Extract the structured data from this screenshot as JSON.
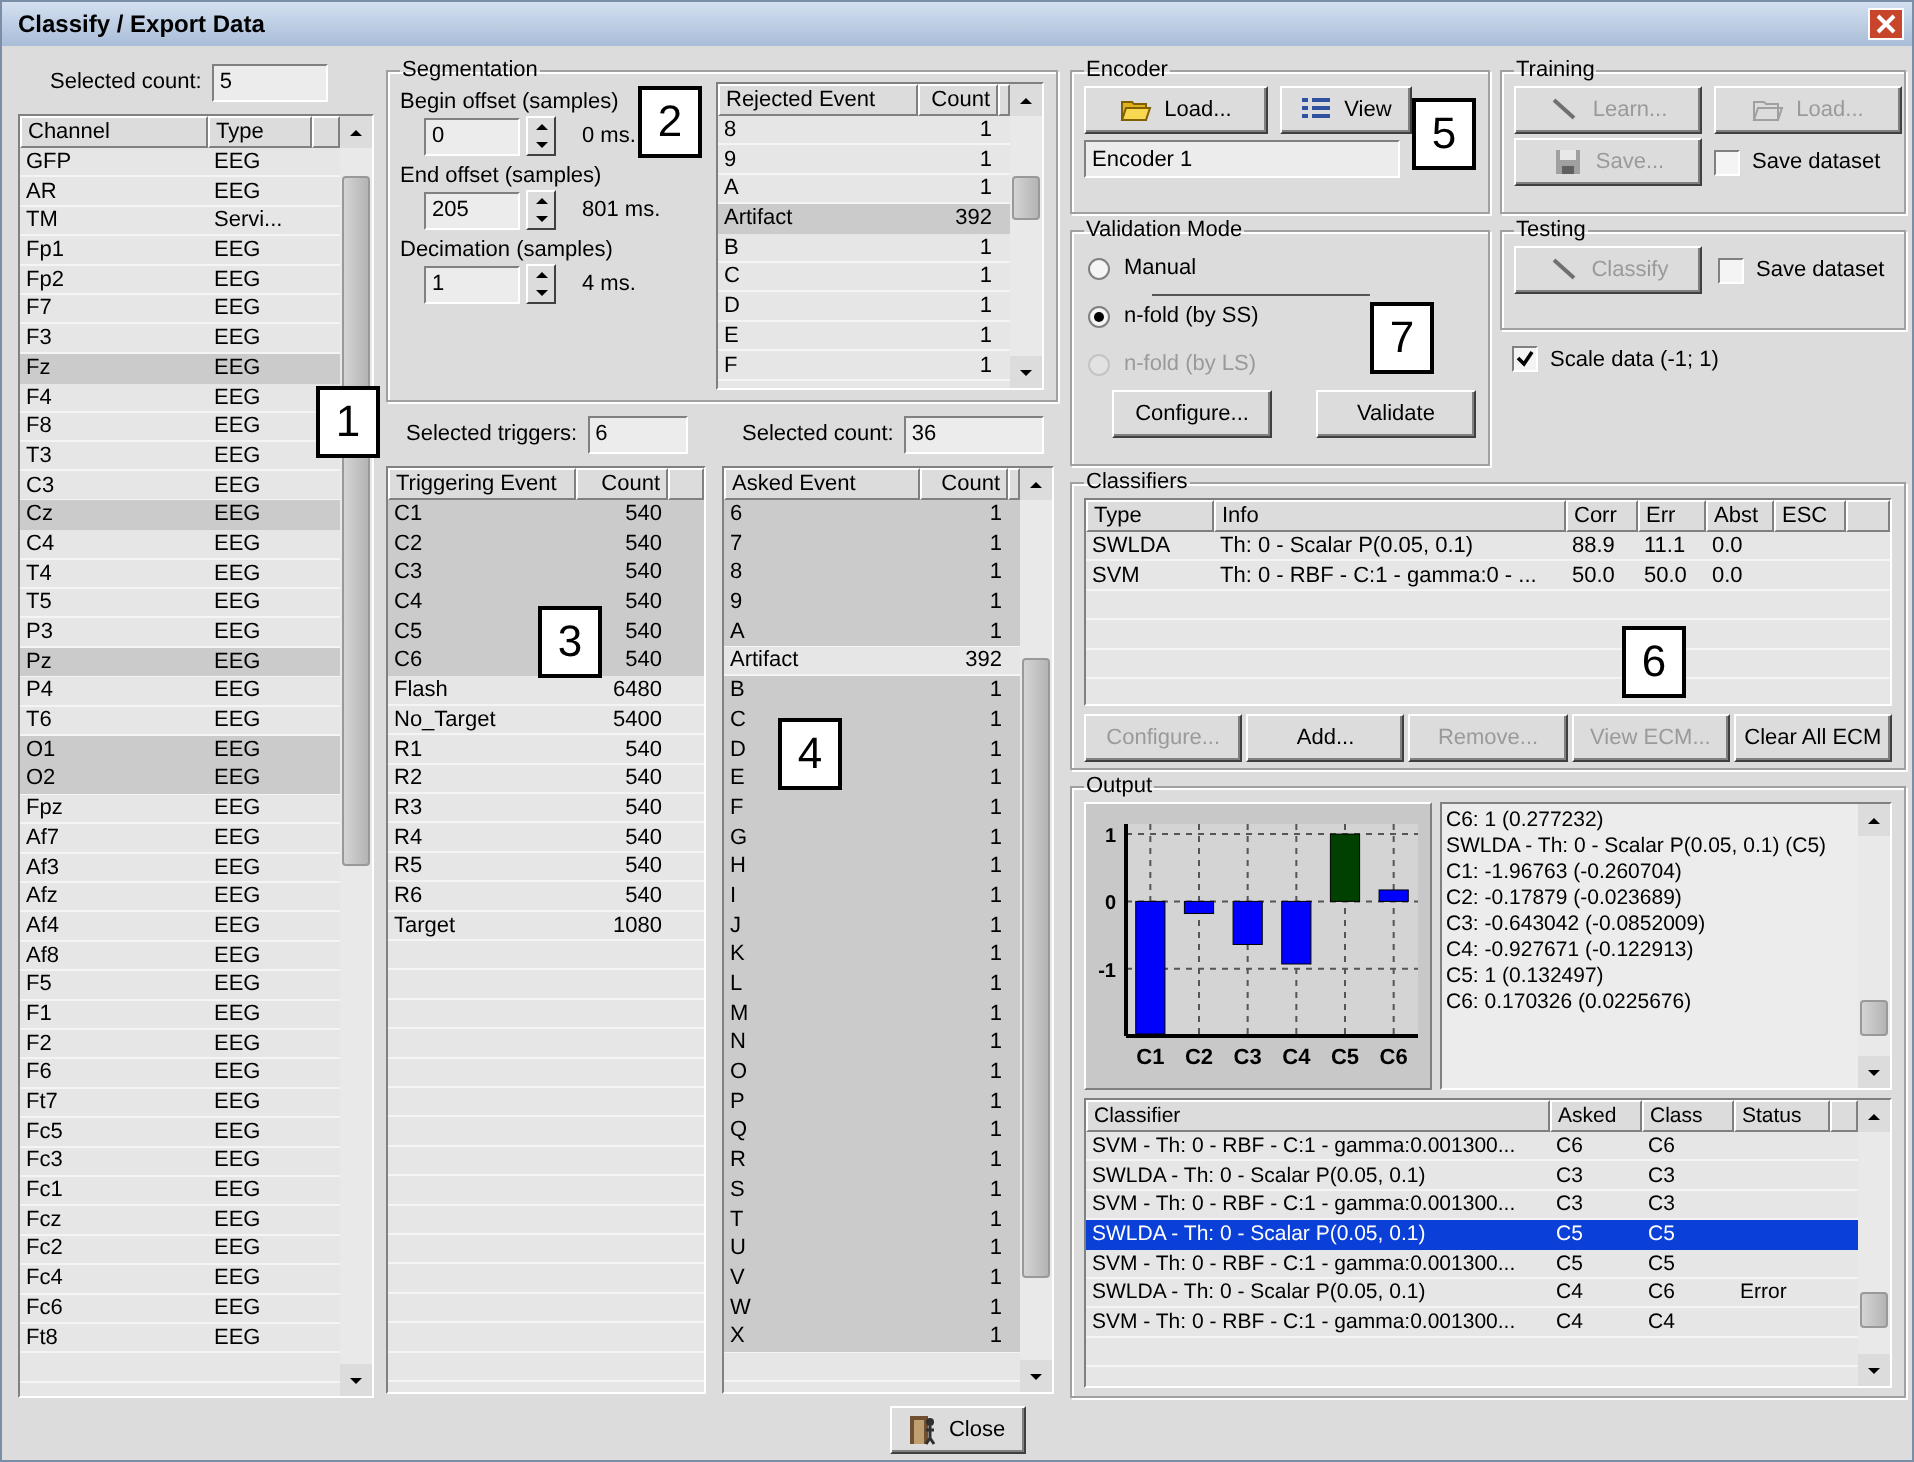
{
  "window": {
    "title": "Classify / Export Data"
  },
  "channels": {
    "count_label": "Selected count:",
    "count": "5",
    "columns": [
      "Channel",
      "Type"
    ],
    "rows": [
      {
        "channel": "GFP",
        "type": "EEG",
        "selected": false
      },
      {
        "channel": "AR",
        "type": "EEG",
        "selected": false
      },
      {
        "channel": "TM",
        "type": "Servi...",
        "selected": false
      },
      {
        "channel": "Fp1",
        "type": "EEG",
        "selected": false
      },
      {
        "channel": "Fp2",
        "type": "EEG",
        "selected": false
      },
      {
        "channel": "F7",
        "type": "EEG",
        "selected": false
      },
      {
        "channel": "F3",
        "type": "EEG",
        "selected": false
      },
      {
        "channel": "Fz",
        "type": "EEG",
        "selected": true
      },
      {
        "channel": "F4",
        "type": "EEG",
        "selected": false
      },
      {
        "channel": "F8",
        "type": "EEG",
        "selected": false
      },
      {
        "channel": "T3",
        "type": "EEG",
        "selected": false
      },
      {
        "channel": "C3",
        "type": "EEG",
        "selected": false
      },
      {
        "channel": "Cz",
        "type": "EEG",
        "selected": true
      },
      {
        "channel": "C4",
        "type": "EEG",
        "selected": false
      },
      {
        "channel": "T4",
        "type": "EEG",
        "selected": false
      },
      {
        "channel": "T5",
        "type": "EEG",
        "selected": false
      },
      {
        "channel": "P3",
        "type": "EEG",
        "selected": false
      },
      {
        "channel": "Pz",
        "type": "EEG",
        "selected": true
      },
      {
        "channel": "P4",
        "type": "EEG",
        "selected": false
      },
      {
        "channel": "T6",
        "type": "EEG",
        "selected": false
      },
      {
        "channel": "O1",
        "type": "EEG",
        "selected": true
      },
      {
        "channel": "O2",
        "type": "EEG",
        "selected": true
      },
      {
        "channel": "Fpz",
        "type": "EEG",
        "selected": false
      },
      {
        "channel": "Af7",
        "type": "EEG",
        "selected": false
      },
      {
        "channel": "Af3",
        "type": "EEG",
        "selected": false
      },
      {
        "channel": "Afz",
        "type": "EEG",
        "selected": false
      },
      {
        "channel": "Af4",
        "type": "EEG",
        "selected": false
      },
      {
        "channel": "Af8",
        "type": "EEG",
        "selected": false
      },
      {
        "channel": "F5",
        "type": "EEG",
        "selected": false
      },
      {
        "channel": "F1",
        "type": "EEG",
        "selected": false
      },
      {
        "channel": "F2",
        "type": "EEG",
        "selected": false
      },
      {
        "channel": "F6",
        "type": "EEG",
        "selected": false
      },
      {
        "channel": "Ft7",
        "type": "EEG",
        "selected": false
      },
      {
        "channel": "Fc5",
        "type": "EEG",
        "selected": false
      },
      {
        "channel": "Fc3",
        "type": "EEG",
        "selected": false
      },
      {
        "channel": "Fc1",
        "type": "EEG",
        "selected": false
      },
      {
        "channel": "Fcz",
        "type": "EEG",
        "selected": false
      },
      {
        "channel": "Fc2",
        "type": "EEG",
        "selected": false
      },
      {
        "channel": "Fc4",
        "type": "EEG",
        "selected": false
      },
      {
        "channel": "Fc6",
        "type": "EEG",
        "selected": false
      },
      {
        "channel": "Ft8",
        "type": "EEG",
        "selected": false
      }
    ]
  },
  "segmentation": {
    "title": "Segmentation",
    "fields": [
      {
        "label": "Begin offset (samples)",
        "value": "0",
        "reading": "0 ms."
      },
      {
        "label": "End offset (samples)",
        "value": "205",
        "reading": "801 ms."
      },
      {
        "label": "Decimation (samples)",
        "value": "1",
        "reading": "4 ms."
      }
    ],
    "rejected": {
      "columns": [
        "Rejected Event",
        "Count"
      ],
      "rows": [
        {
          "event": "8",
          "count": "1",
          "selected": false
        },
        {
          "event": "9",
          "count": "1",
          "selected": false
        },
        {
          "event": "A",
          "count": "1",
          "selected": false
        },
        {
          "event": "Artifact",
          "count": "392",
          "selected": true
        },
        {
          "event": "B",
          "count": "1",
          "selected": false
        },
        {
          "event": "C",
          "count": "1",
          "selected": false
        },
        {
          "event": "D",
          "count": "1",
          "selected": false
        },
        {
          "event": "E",
          "count": "1",
          "selected": false
        },
        {
          "event": "F",
          "count": "1",
          "selected": false
        }
      ]
    }
  },
  "triggers": {
    "count_label": "Selected triggers:",
    "count": "6",
    "columns": [
      "Triggering Event",
      "Count"
    ],
    "rows": [
      {
        "event": "C1",
        "count": "540",
        "selected": true
      },
      {
        "event": "C2",
        "count": "540",
        "selected": true
      },
      {
        "event": "C3",
        "count": "540",
        "selected": true
      },
      {
        "event": "C4",
        "count": "540",
        "selected": true
      },
      {
        "event": "C5",
        "count": "540",
        "selected": true
      },
      {
        "event": "C6",
        "count": "540",
        "selected": true
      },
      {
        "event": "Flash",
        "count": "6480",
        "selected": false
      },
      {
        "event": "No_Target",
        "count": "5400",
        "selected": false
      },
      {
        "event": "R1",
        "count": "540",
        "selected": false
      },
      {
        "event": "R2",
        "count": "540",
        "selected": false
      },
      {
        "event": "R3",
        "count": "540",
        "selected": false
      },
      {
        "event": "R4",
        "count": "540",
        "selected": false
      },
      {
        "event": "R5",
        "count": "540",
        "selected": false
      },
      {
        "event": "R6",
        "count": "540",
        "selected": false
      },
      {
        "event": "Target",
        "count": "1080",
        "selected": false
      }
    ]
  },
  "asked": {
    "count_label": "Selected count:",
    "count": "36",
    "columns": [
      "Asked Event",
      "Count"
    ],
    "rows": [
      {
        "event": "6",
        "count": "1",
        "selected": true
      },
      {
        "event": "7",
        "count": "1",
        "selected": true
      },
      {
        "event": "8",
        "count": "1",
        "selected": true
      },
      {
        "event": "9",
        "count": "1",
        "selected": true
      },
      {
        "event": "A",
        "count": "1",
        "selected": true
      },
      {
        "event": "Artifact",
        "count": "392",
        "selected": false
      },
      {
        "event": "B",
        "count": "1",
        "selected": true
      },
      {
        "event": "C",
        "count": "1",
        "selected": true
      },
      {
        "event": "D",
        "count": "1",
        "selected": true
      },
      {
        "event": "E",
        "count": "1",
        "selected": true
      },
      {
        "event": "F",
        "count": "1",
        "selected": true
      },
      {
        "event": "G",
        "count": "1",
        "selected": true
      },
      {
        "event": "H",
        "count": "1",
        "selected": true
      },
      {
        "event": "I",
        "count": "1",
        "selected": true
      },
      {
        "event": "J",
        "count": "1",
        "selected": true
      },
      {
        "event": "K",
        "count": "1",
        "selected": true
      },
      {
        "event": "L",
        "count": "1",
        "selected": true
      },
      {
        "event": "M",
        "count": "1",
        "selected": true
      },
      {
        "event": "N",
        "count": "1",
        "selected": true
      },
      {
        "event": "O",
        "count": "1",
        "selected": true
      },
      {
        "event": "P",
        "count": "1",
        "selected": true
      },
      {
        "event": "Q",
        "count": "1",
        "selected": true
      },
      {
        "event": "R",
        "count": "1",
        "selected": true
      },
      {
        "event": "S",
        "count": "1",
        "selected": true
      },
      {
        "event": "T",
        "count": "1",
        "selected": true
      },
      {
        "event": "U",
        "count": "1",
        "selected": true
      },
      {
        "event": "V",
        "count": "1",
        "selected": true
      },
      {
        "event": "W",
        "count": "1",
        "selected": true
      },
      {
        "event": "X",
        "count": "1",
        "selected": true
      }
    ]
  },
  "encoder": {
    "title": "Encoder",
    "buttons": [
      {
        "label": "Load...",
        "disabled": false
      },
      {
        "label": "View",
        "disabled": false
      }
    ],
    "value": "Encoder 1"
  },
  "training": {
    "title": "Training",
    "buttons": [
      {
        "label": "Learn...",
        "disabled": true
      },
      {
        "label": "Load...",
        "disabled": true
      },
      {
        "label": "Save...",
        "disabled": true
      }
    ],
    "checkbox": {
      "label": "Save dataset",
      "checked": false
    }
  },
  "validation": {
    "title": "Validation Mode",
    "options": [
      {
        "label": "Manual",
        "selected": false,
        "disabled": false
      },
      {
        "label": "n-fold (by SS)",
        "selected": true,
        "disabled": false
      },
      {
        "label": "n-fold (by LS)",
        "selected": false,
        "disabled": true
      }
    ],
    "buttons": [
      {
        "label": "Configure...",
        "disabled": false
      },
      {
        "label": "Validate",
        "disabled": false
      }
    ]
  },
  "testing": {
    "title": "Testing",
    "buttons": [
      {
        "label": "Classify",
        "disabled": true
      }
    ],
    "checkbox": {
      "label": "Save dataset",
      "checked": false
    }
  },
  "scale_data": {
    "label": "Scale data (-1; 1)",
    "checked": true
  },
  "classifiers": {
    "title": "Classifiers",
    "columns": [
      "Type",
      "Info",
      "Corr",
      "Err",
      "Abst",
      "ESC"
    ],
    "rows": [
      {
        "type": "SWLDA",
        "info": "Th: 0 - Scalar P(0.05, 0.1)",
        "corr": "88.9",
        "err": "11.1",
        "abst": "0.0"
      },
      {
        "type": "SVM",
        "info": "Th: 0 - RBF - C:1 - gamma:0 - ...",
        "corr": "50.0",
        "err": "50.0",
        "abst": "0.0"
      }
    ],
    "buttons": [
      {
        "label": "Configure...",
        "disabled": true
      },
      {
        "label": "Add...",
        "disabled": false
      },
      {
        "label": "Remove...",
        "disabled": true
      },
      {
        "label": "View ECM...",
        "disabled": true
      },
      {
        "label": "Clear All ECM",
        "disabled": false
      }
    ]
  },
  "output": {
    "title": "Output",
    "chart_data": {
      "type": "bar",
      "categories": [
        "C1",
        "C2",
        "C3",
        "C4",
        "C5",
        "C6"
      ],
      "series": [
        {
          "color": "#0000ff",
          "values": [
            -1.97,
            -0.18,
            -0.64,
            -0.93,
            null,
            0.17
          ]
        },
        {
          "color": "#004000",
          "values": [
            null,
            null,
            null,
            null,
            1,
            null
          ]
        }
      ],
      "ylim": [
        -2,
        1.15
      ],
      "yticks": [
        -1,
        0,
        1
      ],
      "stacked": true,
      "grid": true
    },
    "log": [
      "C6: 1 (0.277232)",
      "SWLDA - Th: 0 - Scalar P(0.05, 0.1) (C5)",
      "C1: -1.96763 (-0.260704)",
      "C2: -0.17879 (-0.023689)",
      "C3: -0.643042 (-0.0852009)",
      "C4: -0.927671 (-0.122913)",
      "C5: 1 (0.132497)",
      "C6: 0.170326 (0.0225676)"
    ],
    "results": {
      "columns": [
        "Classifier",
        "Asked",
        "Class",
        "Status"
      ],
      "rows": [
        {
          "classifier": "SVM - Th: 0 - RBF - C:1 - gamma:0.001300...",
          "asked": "C6",
          "class": "C6",
          "selected": false
        },
        {
          "classifier": "SWLDA - Th: 0 - Scalar P(0.05, 0.1)",
          "asked": "C3",
          "class": "C3",
          "selected": false
        },
        {
          "classifier": "SVM - Th: 0 - RBF - C:1 - gamma:0.001300...",
          "asked": "C3",
          "class": "C3",
          "selected": false
        },
        {
          "classifier": "SWLDA - Th: 0 - Scalar P(0.05, 0.1)",
          "asked": "C5",
          "class": "C5",
          "selected": true
        },
        {
          "classifier": "SVM - Th: 0 - RBF - C:1 - gamma:0.001300...",
          "asked": "C5",
          "class": "C5",
          "selected": false
        },
        {
          "classifier": "SWLDA - Th: 0 - Scalar P(0.05, 0.1)",
          "asked": "C4",
          "class": "C6",
          "status": "Error",
          "selected": false
        },
        {
          "classifier": "SVM - Th: 0 - RBF - C:1 - gamma:0.001300...",
          "asked": "C4",
          "class": "C4",
          "selected": false
        }
      ]
    }
  },
  "close_button": {
    "label": "Close"
  },
  "callouts": [
    "1",
    "2",
    "3",
    "4",
    "5",
    "6",
    "7"
  ]
}
